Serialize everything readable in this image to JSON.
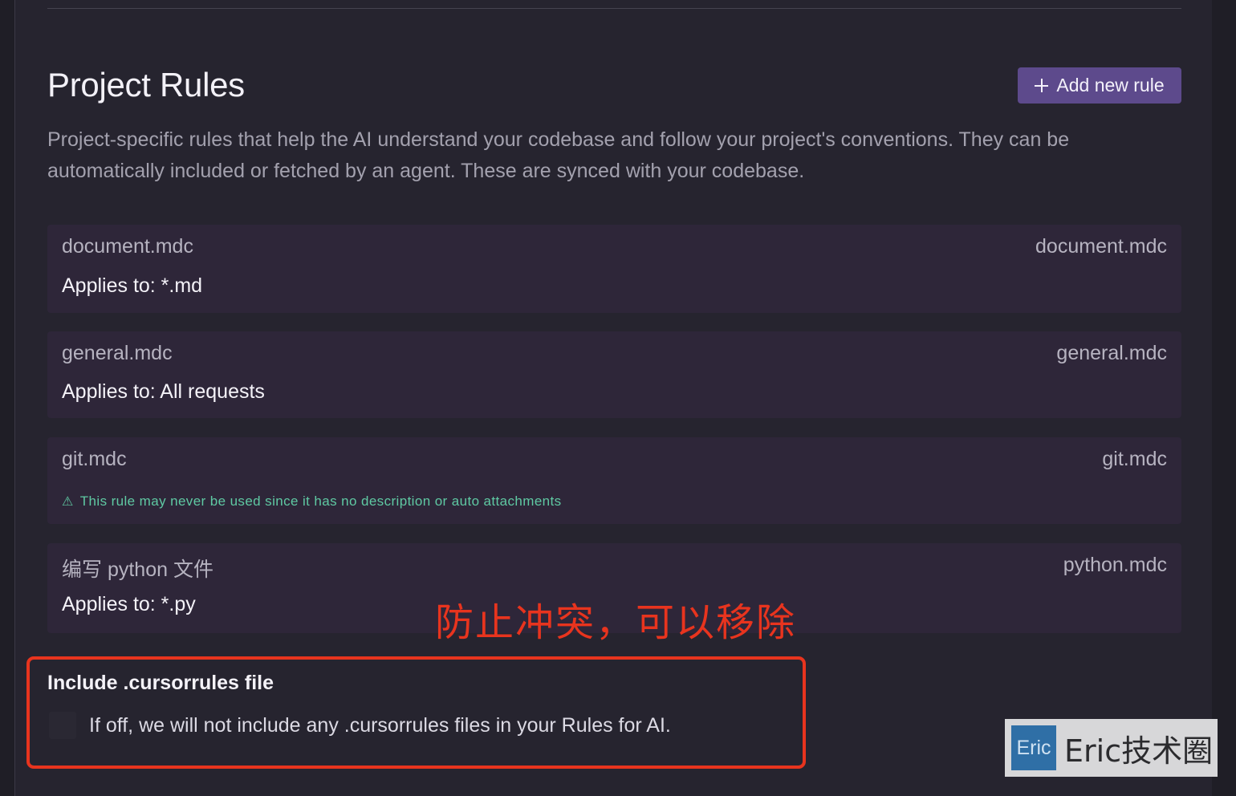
{
  "header": {
    "title": "Project Rules",
    "add_button_label": "Add new rule",
    "description": "Project-specific rules that help the AI understand your codebase and follow your project's conventions. They can be automatically included or fetched by an agent. These are synced with your codebase."
  },
  "rules": [
    {
      "name": "document.mdc",
      "file": "document.mdc",
      "applies": "Applies to: *.md"
    },
    {
      "name": "general.mdc",
      "file": "general.mdc",
      "applies": "Applies to: All requests"
    },
    {
      "name": "git.mdc",
      "file": "git.mdc",
      "warning": "This rule may never be used since it has no description or auto attachments"
    },
    {
      "name": "编写 python 文件",
      "file": "python.mdc",
      "applies": "Applies to: *.py"
    }
  ],
  "annotation": "防止冲突，可以移除",
  "cursorrules": {
    "title": "Include .cursorrules file",
    "description": "If off, we will not include any .cursorrules files in your Rules for AI.",
    "enabled": false
  },
  "watermark": {
    "logo_text": "Eric",
    "text": "Eric技术圈"
  },
  "colors": {
    "background": "#26242f",
    "card": "#2e2639",
    "accent_button": "#5d4a8c",
    "warning": "#5fc9a3",
    "annotation": "#e8341e"
  }
}
